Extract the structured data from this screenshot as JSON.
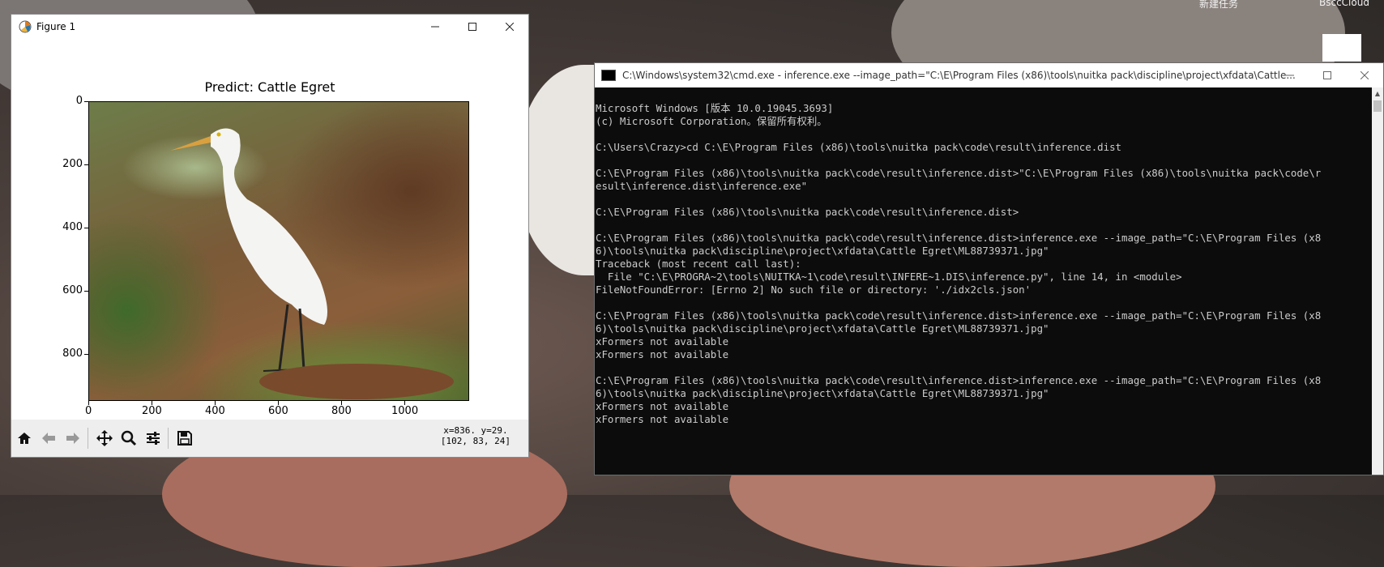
{
  "desktop": {
    "top_labels": [
      "新建任务",
      "BsccCloud"
    ]
  },
  "figure_window": {
    "title": "Figure 1",
    "controls": [
      "minimize",
      "maximize",
      "close"
    ],
    "plot": {
      "title": "Predict: Cattle Egret",
      "y_ticks": [
        "0",
        "200",
        "400",
        "600",
        "800"
      ],
      "x_ticks": [
        "0",
        "200",
        "400",
        "600",
        "800",
        "1000"
      ]
    },
    "toolbar": {
      "tools": [
        "home-icon",
        "back-arrow-icon",
        "forward-arrow-icon",
        "pan-icon",
        "zoom-icon",
        "configure-subplots-icon",
        "save-icon"
      ],
      "coord_line1": "x=836. y=29.",
      "coord_line2": "[102, 83, 24]"
    }
  },
  "cmd_window": {
    "title": "C:\\Windows\\system32\\cmd.exe - inference.exe  --image_path=\"C:\\E\\Program Files (x86)\\tools\\nuitka pack\\discipline\\project\\xfdata\\Cattle...",
    "lines": [
      "Microsoft Windows [版本 10.0.19045.3693]",
      "(c) Microsoft Corporation。保留所有权利。",
      "",
      "C:\\Users\\Crazy>cd C:\\E\\Program Files (x86)\\tools\\nuitka pack\\code\\result\\inference.dist",
      "",
      "C:\\E\\Program Files (x86)\\tools\\nuitka pack\\code\\result\\inference.dist>\"C:\\E\\Program Files (x86)\\tools\\nuitka pack\\code\\r",
      "esult\\inference.dist\\inference.exe\"",
      "",
      "C:\\E\\Program Files (x86)\\tools\\nuitka pack\\code\\result\\inference.dist>",
      "",
      "C:\\E\\Program Files (x86)\\tools\\nuitka pack\\code\\result\\inference.dist>inference.exe --image_path=\"C:\\E\\Program Files (x8",
      "6)\\tools\\nuitka pack\\discipline\\project\\xfdata\\Cattle Egret\\ML88739371.jpg\"",
      "Traceback (most recent call last):",
      "  File \"C:\\E\\PROGRA~2\\tools\\NUITKA~1\\code\\result\\INFERE~1.DIS\\inference.py\", line 14, in <module>",
      "FileNotFoundError: [Errno 2] No such file or directory: './idx2cls.json'",
      "",
      "C:\\E\\Program Files (x86)\\tools\\nuitka pack\\code\\result\\inference.dist>inference.exe --image_path=\"C:\\E\\Program Files (x8",
      "6)\\tools\\nuitka pack\\discipline\\project\\xfdata\\Cattle Egret\\ML88739371.jpg\"",
      "xFormers not available",
      "xFormers not available",
      "",
      "C:\\E\\Program Files (x86)\\tools\\nuitka pack\\code\\result\\inference.dist>inference.exe --image_path=\"C:\\E\\Program Files (x8",
      "6)\\tools\\nuitka pack\\discipline\\project\\xfdata\\Cattle Egret\\ML88739371.jpg\"",
      "xFormers not available",
      "xFormers not available"
    ]
  }
}
